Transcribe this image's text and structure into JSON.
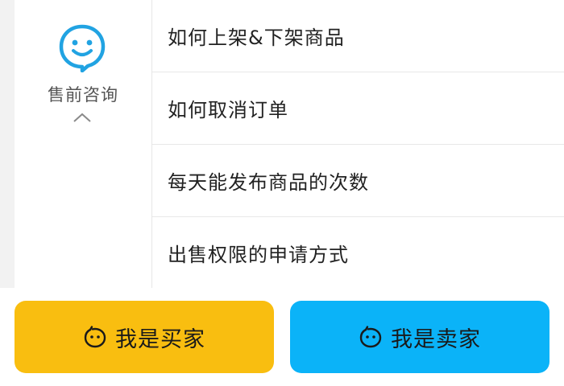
{
  "category": {
    "label": "售前咨询",
    "icon": "chat-smile-icon",
    "toggle_icon": "chevron-up-icon",
    "accent_color": "#21a3e2"
  },
  "questions": [
    "如何上架&下架商品",
    "如何取消订单",
    "每天能发布商品的次数",
    "出售权限的申请方式"
  ],
  "buttons": {
    "buyer": {
      "label": "我是买家",
      "icon": "smile-face-icon",
      "color": "#f9be10"
    },
    "seller": {
      "label": "我是卖家",
      "icon": "smile-face-icon",
      "color": "#0bb3f8"
    }
  }
}
